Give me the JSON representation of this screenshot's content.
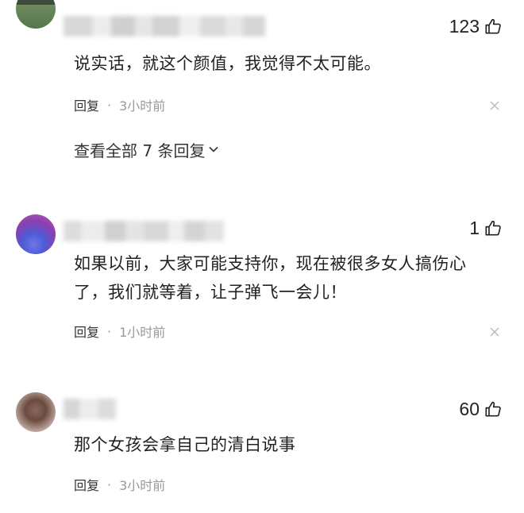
{
  "comments": [
    {
      "likes": "123",
      "text": "说实话，就这个颜值，我觉得不太可能。",
      "reply_label": "回复",
      "time": "3小时前",
      "view_replies": "查看全部 7 条回复"
    },
    {
      "likes": "1",
      "text_line1": "如果以前，大家可能支持你，现在被很多女人搞伤心",
      "text_line2": "了，我们就等着，让子弹飞一会儿！",
      "reply_label": "回复",
      "time": "1小时前"
    },
    {
      "likes": "60",
      "text": "那个女孩会拿自己的清白说事",
      "reply_label": "回复",
      "time": "3小时前"
    }
  ],
  "separator": "·",
  "icons": {
    "like": "thumbs-up-icon",
    "close": "close-icon",
    "expand": "chevron-down-icon"
  }
}
